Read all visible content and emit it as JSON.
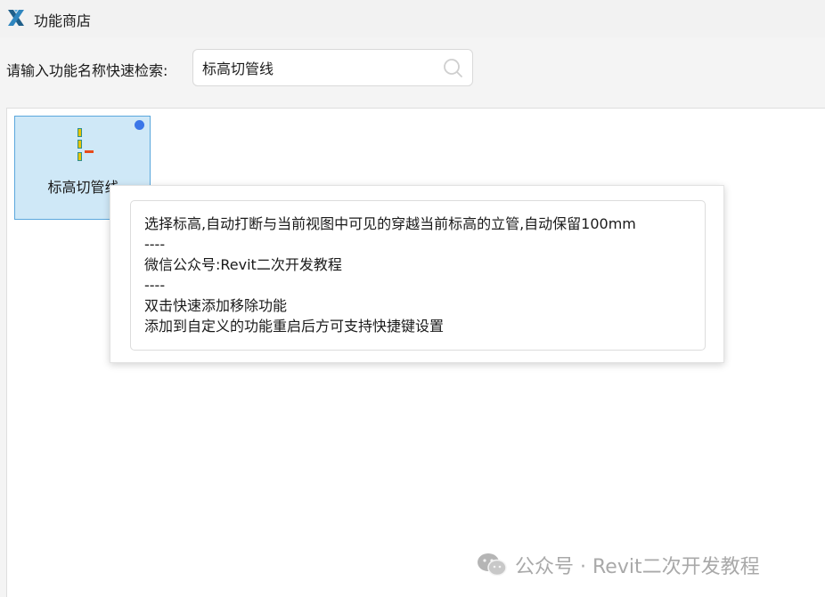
{
  "window": {
    "title": "功能商店"
  },
  "search": {
    "label": "请输入功能名称快速检索:",
    "value": "标高切管线",
    "placeholder": ""
  },
  "tiles": [
    {
      "label": "标高切管线",
      "icon": "pipe-cut-icon",
      "badge_color": "#3b76e8"
    }
  ],
  "tooltip": {
    "lines": [
      "选择标高,自动打断与当前视图中可见的穿越当前标高的立管,自动保留100mm",
      "----",
      "微信公众号:Revit二次开发教程",
      "----",
      "双击快速添加移除功能",
      "添加到自定义的功能重启后方可支持快捷键设置"
    ]
  },
  "watermark": {
    "text": "公众号 · Revit二次开发教程",
    "icon": "wechat-icon"
  },
  "colors": {
    "tile_bg": "#cfe8f7",
    "tile_border": "#5aa7dc",
    "badge": "#3b76e8",
    "logo": "#2f6f9f"
  }
}
